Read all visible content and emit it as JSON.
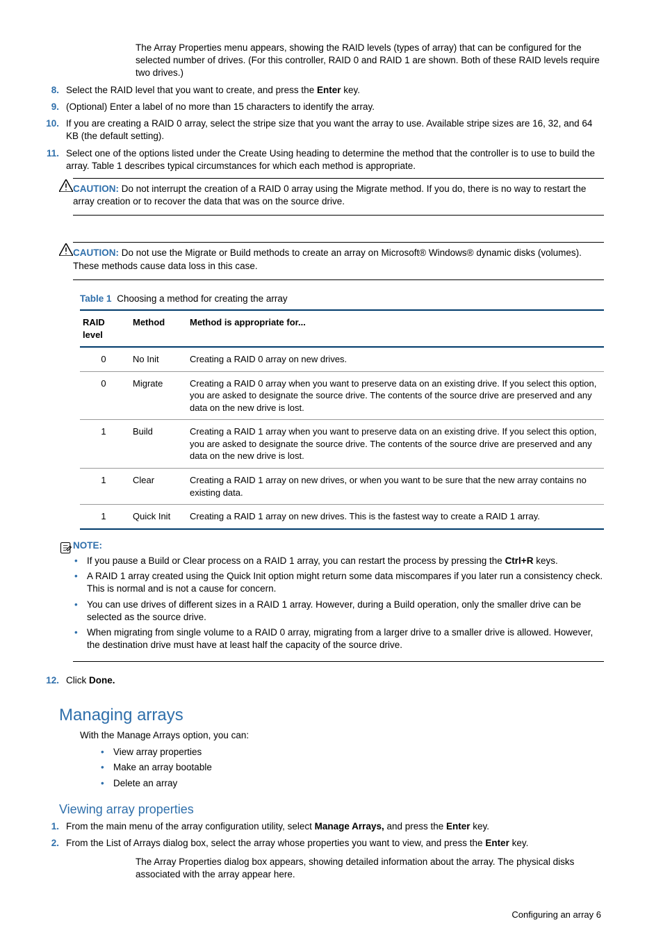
{
  "para_intro": "The Array Properties menu appears, showing the RAID levels (types of array) that can be configured for the selected number of drives. (For this controller, RAID 0 and RAID 1 are shown. Both of these RAID levels require two drives.)",
  "steps_a": [
    {
      "n": "8.",
      "t_pre": "Select the RAID level that you want to create, and press the ",
      "b": "Enter",
      "t_post": " key."
    },
    {
      "n": "9.",
      "t_pre": "(Optional) Enter a label of no more than 15 characters to identify the array.",
      "b": "",
      "t_post": ""
    },
    {
      "n": "10.",
      "t_pre": "If you are creating a RAID 0 array, select the stripe size that you want the array to use. Available stripe sizes are 16, 32, and 64 KB (the default setting).",
      "b": "",
      "t_post": ""
    },
    {
      "n": "11.",
      "t_pre": "Select one of the options listed under the Create Using heading to determine the method that the controller is to use to build the array. Table 1 describes typical circumstances for which each method is appropriate.",
      "b": "",
      "t_post": ""
    }
  ],
  "caution1_label": "CAUTION:",
  "caution1_text": "  Do not interrupt the creation of a RAID 0 array using the Migrate method. If you do, there is no way to restart the array creation or to recover the data that was on the source drive.",
  "caution2_label": "CAUTION:",
  "caution2_text": "  Do not use the Migrate or Build methods to create an array on Microsoft® Windows® dynamic disks (volumes). These methods cause data loss in this case.",
  "table_caption_label": "Table 1",
  "table_caption_text": "  Choosing a method for creating the array",
  "table_headers": {
    "c1": "RAID level",
    "c2": "Method",
    "c3": "Method is appropriate for..."
  },
  "table_rows": [
    {
      "c1": "0",
      "c2": "No Init",
      "c3": "Creating a RAID 0 array on new drives."
    },
    {
      "c1": "0",
      "c2": "Migrate",
      "c3": "Creating a RAID 0 array when you want to preserve data on an existing drive. If you select this option, you are asked to designate the source drive. The contents of the source drive are preserved and any data on the new drive is lost."
    },
    {
      "c1": "1",
      "c2": "Build",
      "c3": "Creating a RAID 1 array when you want to preserve data on an existing drive. If you select this option, you are asked to designate the source drive. The contents of the source drive are preserved and any data on the new drive is lost."
    },
    {
      "c1": "1",
      "c2": "Clear",
      "c3": "Creating a RAID 1 array on new drives, or when you want to be sure that the new array contains no existing data."
    },
    {
      "c1": "1",
      "c2": "Quick Init",
      "c3": "Creating a RAID 1 array on new drives. This is the fastest way to create a RAID 1 array."
    }
  ],
  "note_label": "NOTE:",
  "note_items": [
    {
      "pre": "If you pause a Build or Clear process on a RAID 1 array, you can restart the process by pressing the ",
      "b": "Ctrl+R",
      "post": " keys."
    },
    {
      "pre": "A RAID 1 array created using the Quick Init option might return some data miscompares if you later run a consistency check. This is normal and is not a cause for concern.",
      "b": "",
      "post": ""
    },
    {
      "pre": "You can use drives of different sizes in a RAID 1 array. However, during a Build operation, only the smaller drive can be selected as the source drive.",
      "b": "",
      "post": ""
    },
    {
      "pre": "When migrating from single volume to a RAID 0 array, migrating from a larger drive to a smaller drive is allowed. However, the destination drive must have at least half the capacity of the source drive.",
      "b": "",
      "post": ""
    }
  ],
  "step12_n": "12.",
  "step12_pre": "Click ",
  "step12_b": "Done.",
  "h2": "Managing arrays",
  "h2_intro": "With the Manage Arrays option, you can:",
  "h2_items": [
    "View array properties",
    "Make an array bootable",
    "Delete an array"
  ],
  "h3": "Viewing array properties",
  "steps_b": [
    {
      "n": "1.",
      "pre": "From the main menu of the array configuration utility, select ",
      "b1": "Manage Arrays,",
      "mid": " and press the ",
      "b2": "Enter",
      "post": " key."
    },
    {
      "n": "2.",
      "pre": "From the List of Arrays dialog box, select the array whose properties you want to view, and press the ",
      "b1": "Enter",
      "mid": " key.",
      "b2": "",
      "post": ""
    }
  ],
  "para_b": "The Array Properties dialog box appears, showing detailed information about the array. The physical disks associated with the array appear here.",
  "footer": "Configuring an array   6"
}
